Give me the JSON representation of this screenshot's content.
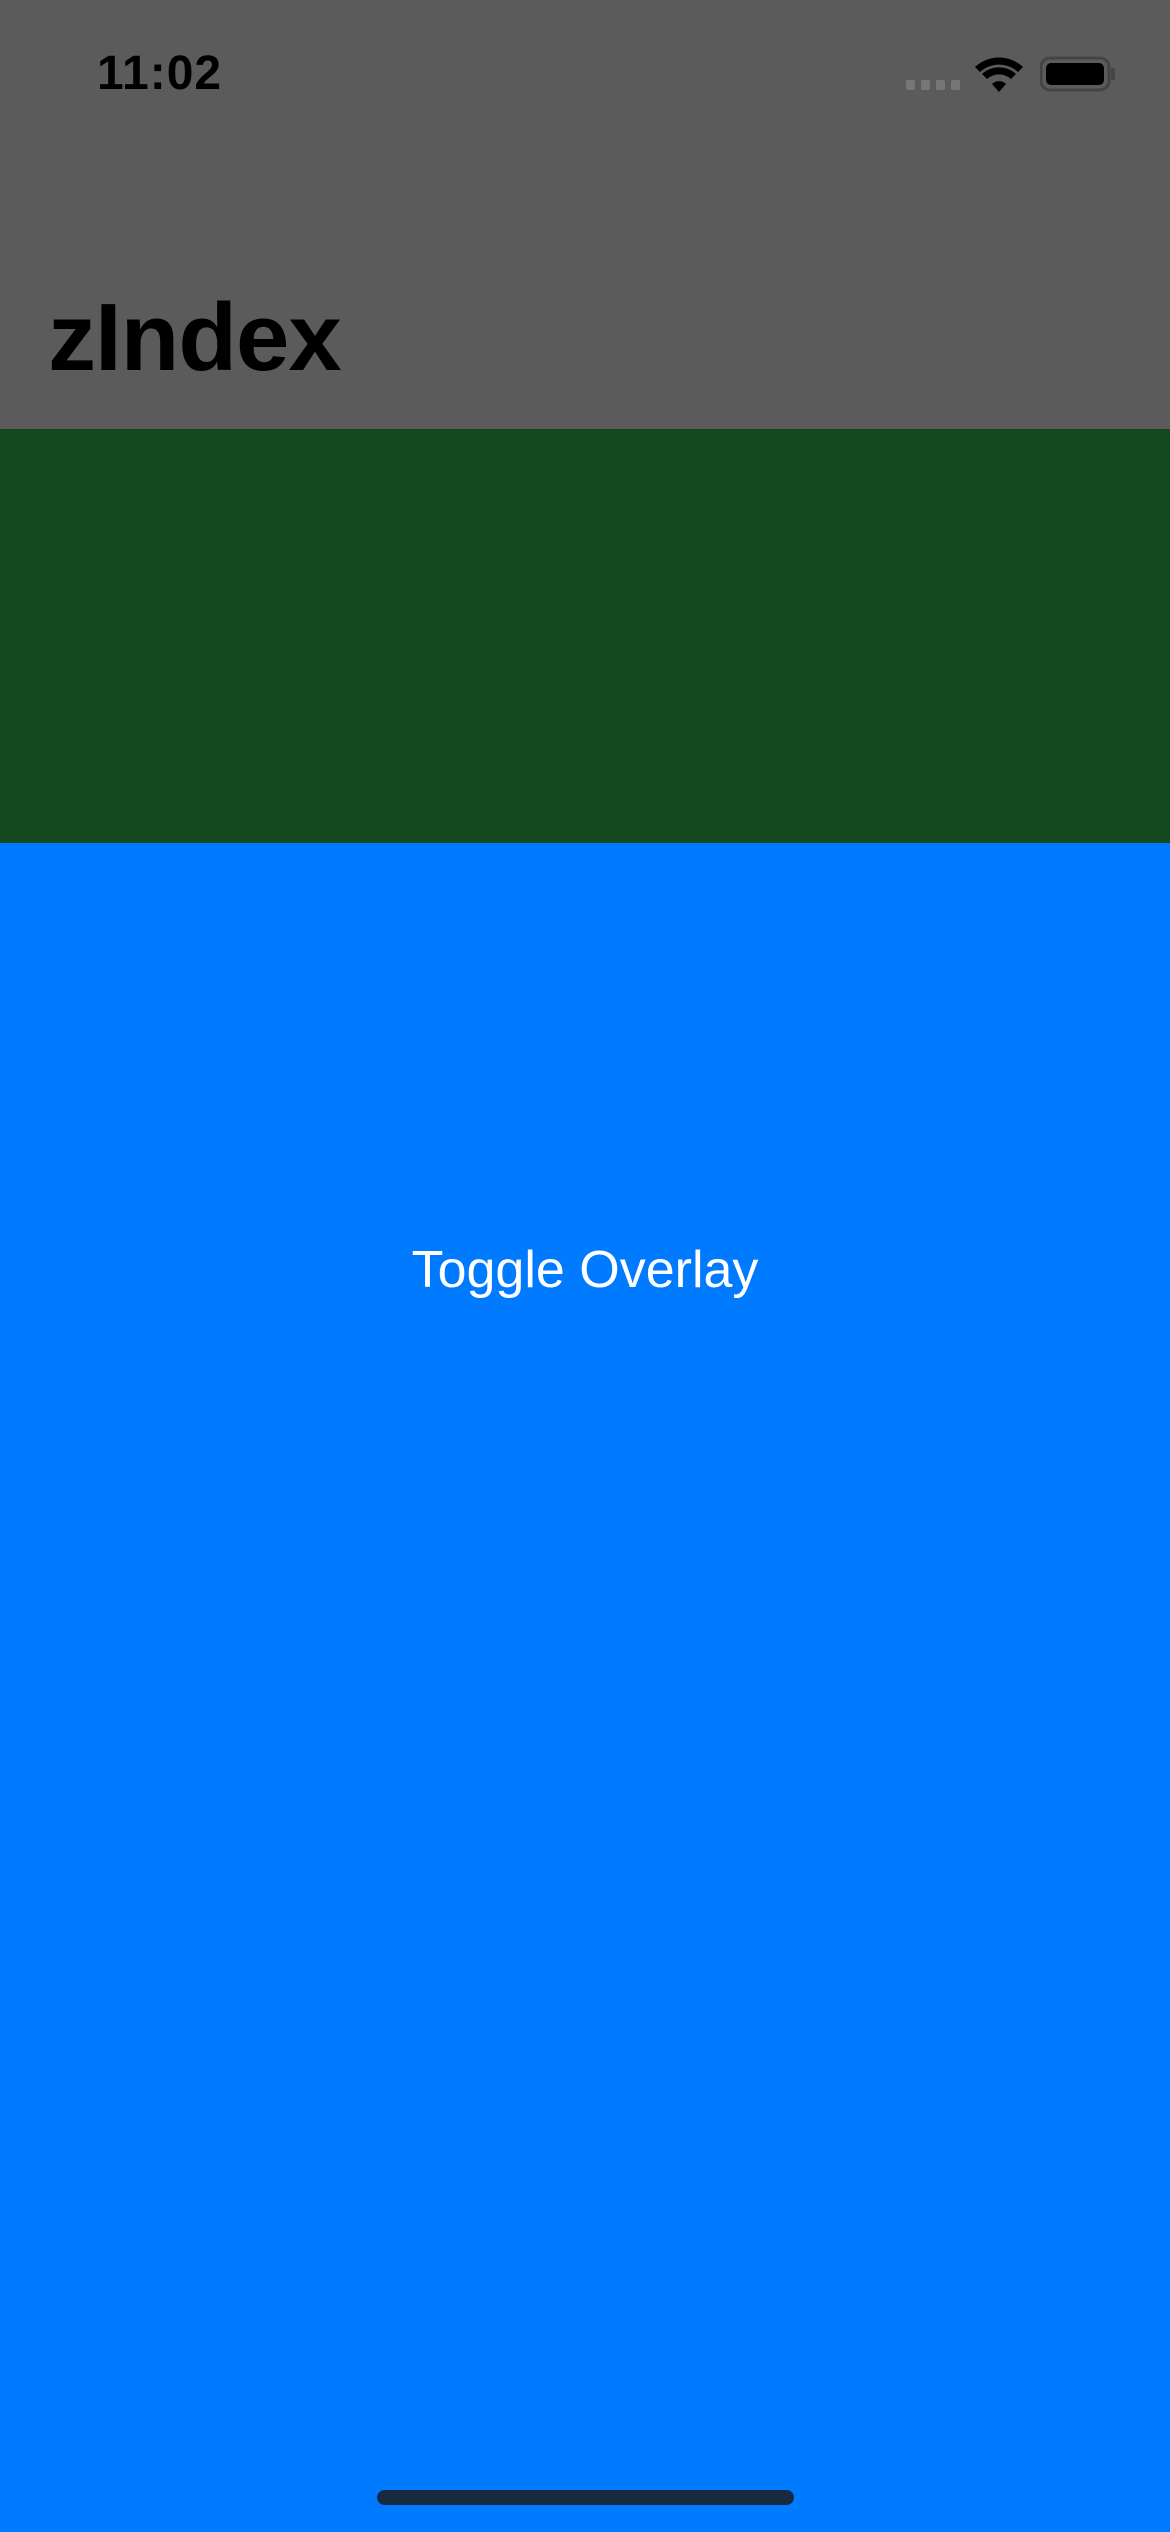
{
  "status_bar": {
    "time": "11:02",
    "icons": [
      "cellular-signal-icon",
      "wifi-icon",
      "battery-icon"
    ]
  },
  "navigation": {
    "title": "zIndex"
  },
  "content": {
    "toggle_button_label": "Toggle Overlay"
  },
  "colors": {
    "top_region": "#5b5b5b",
    "green_band": "#144920",
    "blue_area": "#007aff",
    "button_text": "#ffffff"
  }
}
